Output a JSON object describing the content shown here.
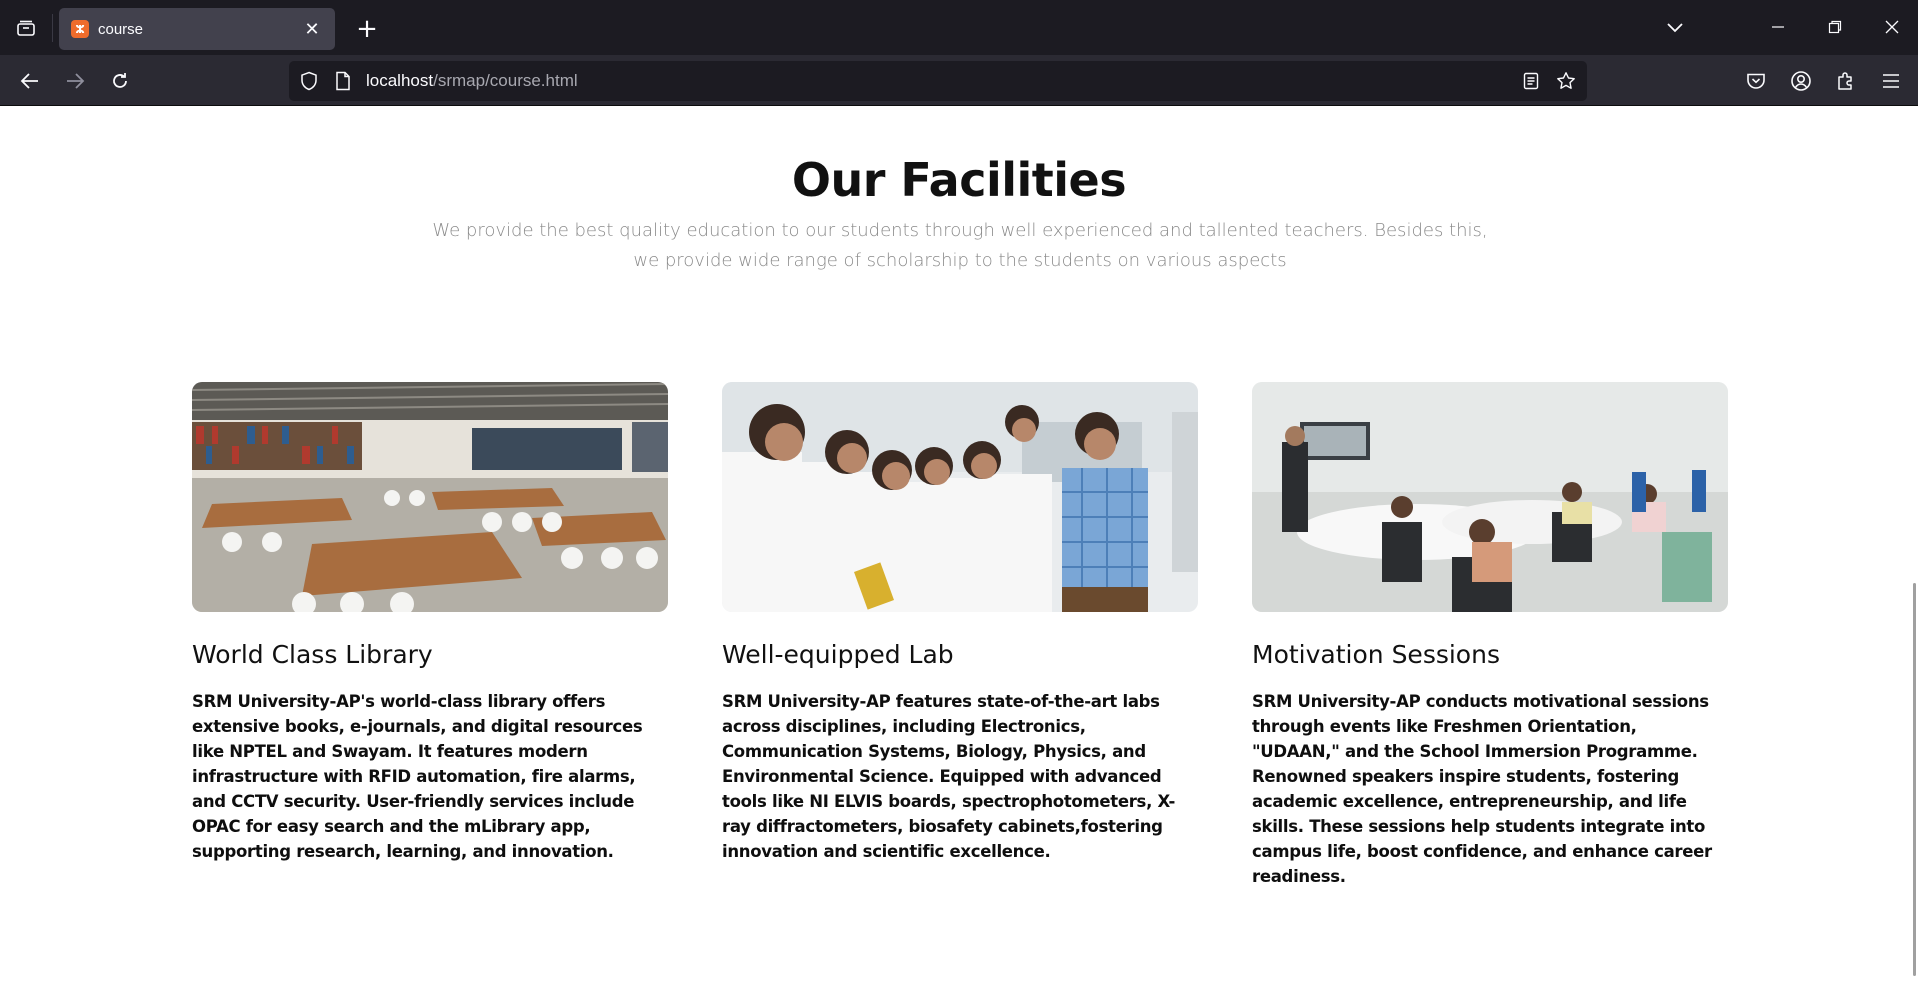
{
  "browser": {
    "tab_title": "course",
    "url_host": "localhost",
    "url_path": "/srmap/course.html"
  },
  "section": {
    "title": "Our Facilities",
    "subtitle": "We provide the best quality education to our students through well experienced and tallented teachers. Besides this, we provide wide range of scholarship to the students on various aspects"
  },
  "cards": [
    {
      "title": "World Class Library",
      "text": "SRM University-AP's world-class library offers extensive books, e-journals, and digital resources like NPTEL and Swayam. It features modern infrastructure with RFID automation, fire alarms, and CCTV security. User-friendly services include OPAC for easy search and the mLibrary app, supporting research, learning, and innovation."
    },
    {
      "title": "Well-equipped Lab",
      "text": "SRM University-AP features state-of-the-art labs across disciplines, including Electronics, Communication Systems, Biology, Physics, and Environmental Science. Equipped with advanced tools like NI ELVIS boards, spectrophotometers, X-ray diffractometers, biosafety cabinets,fostering innovation and scientific excellence."
    },
    {
      "title": "Motivation Sessions",
      "text": "SRM University-AP conducts motivational sessions through events like Freshmen Orientation, \"UDAAN,\" and the School Immersion Programme. Renowned speakers inspire students, fostering academic excellence, entrepreneurship, and life skills. These sessions help students integrate into campus life, boost confidence, and enhance career readiness."
    }
  ],
  "colors": {
    "tabbar_bg": "#1c1b22",
    "navbar_bg": "#2b2a33",
    "tab_active_bg": "#42414d",
    "heading": "#111111",
    "subtitle": "#8a8a8a"
  }
}
